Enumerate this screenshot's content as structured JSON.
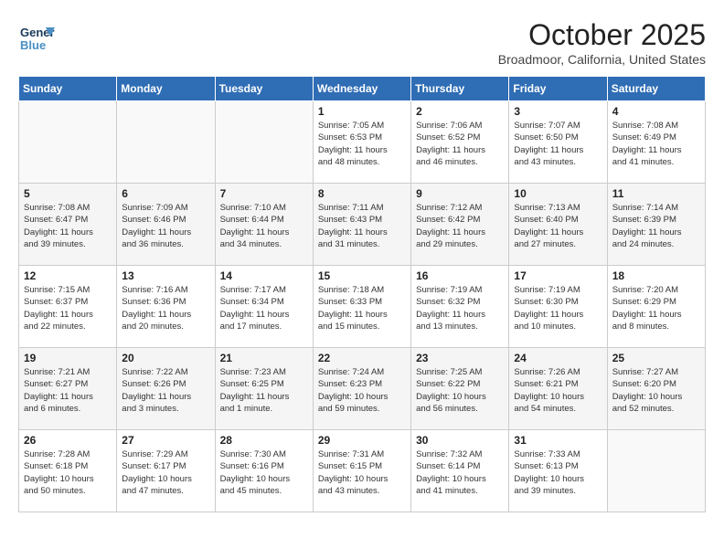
{
  "header": {
    "logo_line1": "General",
    "logo_line2": "Blue",
    "month": "October 2025",
    "location": "Broadmoor, California, United States"
  },
  "days_of_week": [
    "Sunday",
    "Monday",
    "Tuesday",
    "Wednesday",
    "Thursday",
    "Friday",
    "Saturday"
  ],
  "weeks": [
    [
      {
        "day": "",
        "info": ""
      },
      {
        "day": "",
        "info": ""
      },
      {
        "day": "",
        "info": ""
      },
      {
        "day": "1",
        "info": "Sunrise: 7:05 AM\nSunset: 6:53 PM\nDaylight: 11 hours\nand 48 minutes."
      },
      {
        "day": "2",
        "info": "Sunrise: 7:06 AM\nSunset: 6:52 PM\nDaylight: 11 hours\nand 46 minutes."
      },
      {
        "day": "3",
        "info": "Sunrise: 7:07 AM\nSunset: 6:50 PM\nDaylight: 11 hours\nand 43 minutes."
      },
      {
        "day": "4",
        "info": "Sunrise: 7:08 AM\nSunset: 6:49 PM\nDaylight: 11 hours\nand 41 minutes."
      }
    ],
    [
      {
        "day": "5",
        "info": "Sunrise: 7:08 AM\nSunset: 6:47 PM\nDaylight: 11 hours\nand 39 minutes."
      },
      {
        "day": "6",
        "info": "Sunrise: 7:09 AM\nSunset: 6:46 PM\nDaylight: 11 hours\nand 36 minutes."
      },
      {
        "day": "7",
        "info": "Sunrise: 7:10 AM\nSunset: 6:44 PM\nDaylight: 11 hours\nand 34 minutes."
      },
      {
        "day": "8",
        "info": "Sunrise: 7:11 AM\nSunset: 6:43 PM\nDaylight: 11 hours\nand 31 minutes."
      },
      {
        "day": "9",
        "info": "Sunrise: 7:12 AM\nSunset: 6:42 PM\nDaylight: 11 hours\nand 29 minutes."
      },
      {
        "day": "10",
        "info": "Sunrise: 7:13 AM\nSunset: 6:40 PM\nDaylight: 11 hours\nand 27 minutes."
      },
      {
        "day": "11",
        "info": "Sunrise: 7:14 AM\nSunset: 6:39 PM\nDaylight: 11 hours\nand 24 minutes."
      }
    ],
    [
      {
        "day": "12",
        "info": "Sunrise: 7:15 AM\nSunset: 6:37 PM\nDaylight: 11 hours\nand 22 minutes."
      },
      {
        "day": "13",
        "info": "Sunrise: 7:16 AM\nSunset: 6:36 PM\nDaylight: 11 hours\nand 20 minutes."
      },
      {
        "day": "14",
        "info": "Sunrise: 7:17 AM\nSunset: 6:34 PM\nDaylight: 11 hours\nand 17 minutes."
      },
      {
        "day": "15",
        "info": "Sunrise: 7:18 AM\nSunset: 6:33 PM\nDaylight: 11 hours\nand 15 minutes."
      },
      {
        "day": "16",
        "info": "Sunrise: 7:19 AM\nSunset: 6:32 PM\nDaylight: 11 hours\nand 13 minutes."
      },
      {
        "day": "17",
        "info": "Sunrise: 7:19 AM\nSunset: 6:30 PM\nDaylight: 11 hours\nand 10 minutes."
      },
      {
        "day": "18",
        "info": "Sunrise: 7:20 AM\nSunset: 6:29 PM\nDaylight: 11 hours\nand 8 minutes."
      }
    ],
    [
      {
        "day": "19",
        "info": "Sunrise: 7:21 AM\nSunset: 6:27 PM\nDaylight: 11 hours\nand 6 minutes."
      },
      {
        "day": "20",
        "info": "Sunrise: 7:22 AM\nSunset: 6:26 PM\nDaylight: 11 hours\nand 3 minutes."
      },
      {
        "day": "21",
        "info": "Sunrise: 7:23 AM\nSunset: 6:25 PM\nDaylight: 11 hours\nand 1 minute."
      },
      {
        "day": "22",
        "info": "Sunrise: 7:24 AM\nSunset: 6:23 PM\nDaylight: 10 hours\nand 59 minutes."
      },
      {
        "day": "23",
        "info": "Sunrise: 7:25 AM\nSunset: 6:22 PM\nDaylight: 10 hours\nand 56 minutes."
      },
      {
        "day": "24",
        "info": "Sunrise: 7:26 AM\nSunset: 6:21 PM\nDaylight: 10 hours\nand 54 minutes."
      },
      {
        "day": "25",
        "info": "Sunrise: 7:27 AM\nSunset: 6:20 PM\nDaylight: 10 hours\nand 52 minutes."
      }
    ],
    [
      {
        "day": "26",
        "info": "Sunrise: 7:28 AM\nSunset: 6:18 PM\nDaylight: 10 hours\nand 50 minutes."
      },
      {
        "day": "27",
        "info": "Sunrise: 7:29 AM\nSunset: 6:17 PM\nDaylight: 10 hours\nand 47 minutes."
      },
      {
        "day": "28",
        "info": "Sunrise: 7:30 AM\nSunset: 6:16 PM\nDaylight: 10 hours\nand 45 minutes."
      },
      {
        "day": "29",
        "info": "Sunrise: 7:31 AM\nSunset: 6:15 PM\nDaylight: 10 hours\nand 43 minutes."
      },
      {
        "day": "30",
        "info": "Sunrise: 7:32 AM\nSunset: 6:14 PM\nDaylight: 10 hours\nand 41 minutes."
      },
      {
        "day": "31",
        "info": "Sunrise: 7:33 AM\nSunset: 6:13 PM\nDaylight: 10 hours\nand 39 minutes."
      },
      {
        "day": "",
        "info": ""
      }
    ]
  ]
}
